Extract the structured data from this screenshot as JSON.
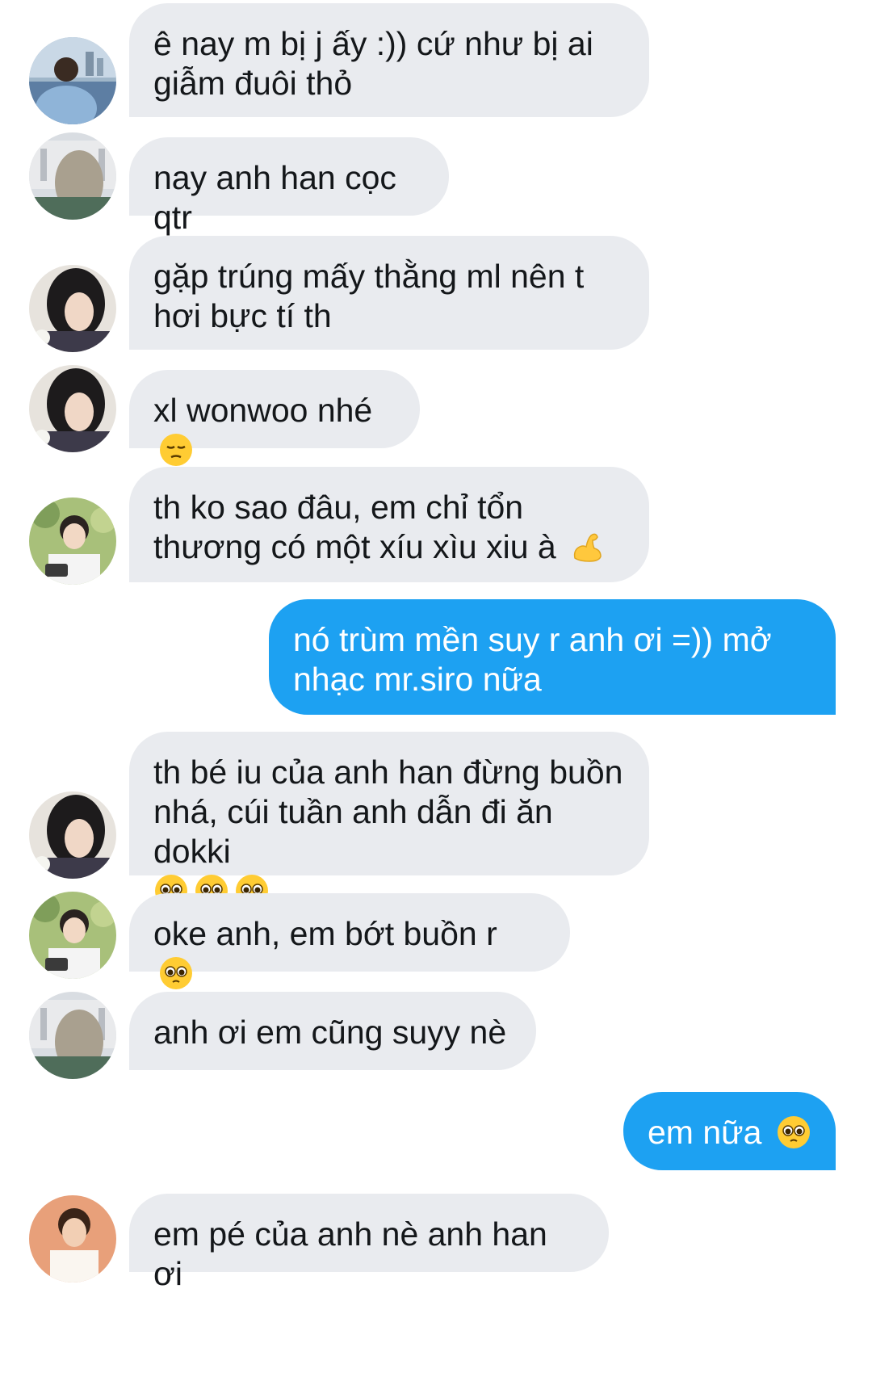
{
  "messages": [
    {
      "text": "ê nay m bị j ấy :)) cứ như bị ai giẫm đuôi thỏ",
      "emojis": [],
      "avatar": "avatar-a"
    },
    {
      "text": "nay anh han cọc qtr",
      "emojis": [],
      "avatar": "avatar-b"
    },
    {
      "text": "gặp trúng mấy thằng ml nên t hơi bực tí th",
      "emojis": [],
      "avatar": "avatar-c"
    },
    {
      "text": "xl wonwoo nhé",
      "emojis": [
        "pensive-face-emoji"
      ],
      "avatar": "avatar-c"
    },
    {
      "text": "th ko sao đâu, em chỉ tổn thương có một xíu xìu xiu à",
      "emojis": [
        "flexed-biceps-emoji"
      ],
      "avatar": "avatar-d"
    },
    {
      "text": "nó trùm mền suy r anh ơi =)) mở nhạc mr.siro nữa",
      "emojis": [],
      "avatar": null
    },
    {
      "text": "th bé iu của anh han đừng buồn nhá, cúi tuần anh dẫn đi ăn dokki",
      "emojis": [
        "pleading-face-emoji",
        "pleading-face-emoji",
        "pleading-face-emoji"
      ],
      "avatar": "avatar-c"
    },
    {
      "text": "oke anh, em bớt buồn r",
      "emojis": [
        "pleading-face-emoji"
      ],
      "avatar": "avatar-d"
    },
    {
      "text": "anh ơi em cũng suyy nè",
      "emojis": [],
      "avatar": "avatar-b"
    },
    {
      "text": "em nữa",
      "emojis": [
        "pleading-face-emoji"
      ],
      "avatar": null
    },
    {
      "text": "em pé của anh nè anh han ơi",
      "emojis": [],
      "avatar": "avatar-e"
    }
  ],
  "colors": {
    "incoming_bubble": "#e9ebef",
    "outgoing_bubble": "#1da1f2",
    "incoming_text": "#14171a",
    "outgoing_text": "#ffffff"
  }
}
